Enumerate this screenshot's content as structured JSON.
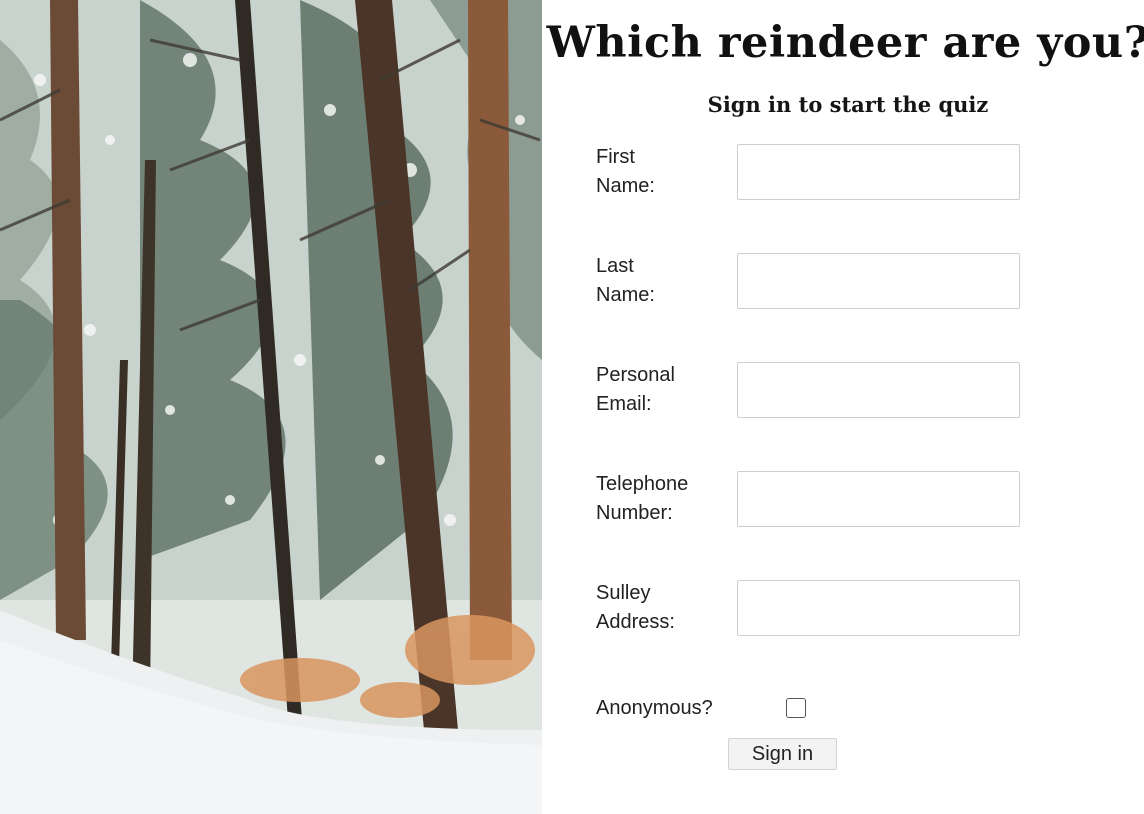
{
  "hero": {
    "image_description_icon": "snowy-forest-image"
  },
  "header": {
    "title": "Which reindeer are you?",
    "subtitle": "Sign in to start the quiz"
  },
  "form": {
    "first_name": {
      "label_line1": "First",
      "label_line2": "Name:",
      "value": ""
    },
    "last_name": {
      "label_line1": "Last",
      "label_line2": "Name:",
      "value": ""
    },
    "email": {
      "label_line1": "Personal",
      "label_line2": "Email:",
      "value": ""
    },
    "telephone": {
      "label_line1": "Telephone",
      "label_line2": "Number:",
      "value": ""
    },
    "address": {
      "label_line1": "Sulley",
      "label_line2": "Address:",
      "value": ""
    },
    "anonymous": {
      "label": "Anonymous?",
      "checked": false
    },
    "submit_label": "Sign in"
  },
  "colors": {
    "background": "#ffffff",
    "input_border": "#cfcfcf",
    "button_bg": "#f3f3f3",
    "text": "#222222"
  }
}
